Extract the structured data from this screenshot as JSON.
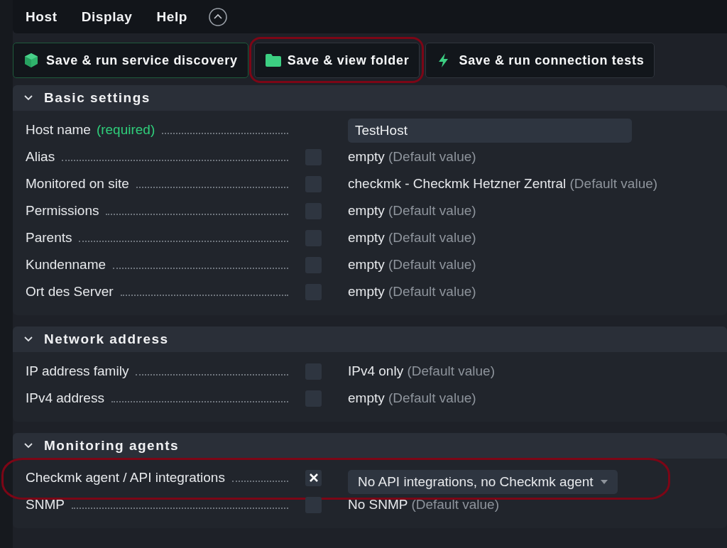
{
  "menu": [
    {
      "label": "Host"
    },
    {
      "label": "Display"
    },
    {
      "label": "Help"
    }
  ],
  "actions": [
    {
      "label": "Save & run service discovery",
      "primary": true,
      "highlighted": false
    },
    {
      "label": "Save & view folder",
      "primary": false,
      "highlighted": true
    },
    {
      "label": "Save & run connection tests",
      "primary": false,
      "highlighted": false
    }
  ],
  "sections": [
    {
      "title": "Basic settings",
      "expanded": true,
      "rows": [
        {
          "label": "Host name",
          "required": "(required)",
          "kind": "input",
          "value": "TestHost",
          "highlighted": false
        },
        {
          "label": "Alias",
          "kind": "text",
          "checked": false,
          "value": "empty",
          "note": "(Default value)",
          "highlighted": false
        },
        {
          "label": "Monitored on site",
          "kind": "text",
          "checked": false,
          "value": "checkmk - Checkmk Hetzner Zentral",
          "note": "(Default value)",
          "highlighted": false
        },
        {
          "label": "Permissions",
          "kind": "text",
          "checked": false,
          "value": "empty",
          "note": "(Default value)",
          "highlighted": false
        },
        {
          "label": "Parents",
          "kind": "text",
          "checked": false,
          "value": "empty",
          "note": "(Default value)",
          "highlighted": false
        },
        {
          "label": "Kundenname",
          "kind": "text",
          "checked": false,
          "value": "empty",
          "note": "(Default value)",
          "highlighted": false
        },
        {
          "label": "Ort des Server",
          "kind": "text",
          "checked": false,
          "value": "empty",
          "note": "(Default value)",
          "highlighted": false
        }
      ]
    },
    {
      "title": "Network address",
      "expanded": true,
      "rows": [
        {
          "label": "IP address family",
          "kind": "text",
          "checked": false,
          "value": "IPv4 only",
          "note": "(Default value)",
          "highlighted": false
        },
        {
          "label": "IPv4 address",
          "kind": "text",
          "checked": false,
          "value": "empty",
          "note": "(Default value)",
          "highlighted": false
        }
      ]
    },
    {
      "title": "Monitoring agents",
      "expanded": true,
      "rows": [
        {
          "label": "Checkmk agent / API integrations",
          "kind": "select",
          "checked": true,
          "value": "No API integrations, no Checkmk agent",
          "highlighted": true
        },
        {
          "label": "SNMP",
          "kind": "text",
          "checked": false,
          "value": "No SNMP",
          "note": "(Default value)",
          "highlighted": false
        }
      ]
    }
  ]
}
